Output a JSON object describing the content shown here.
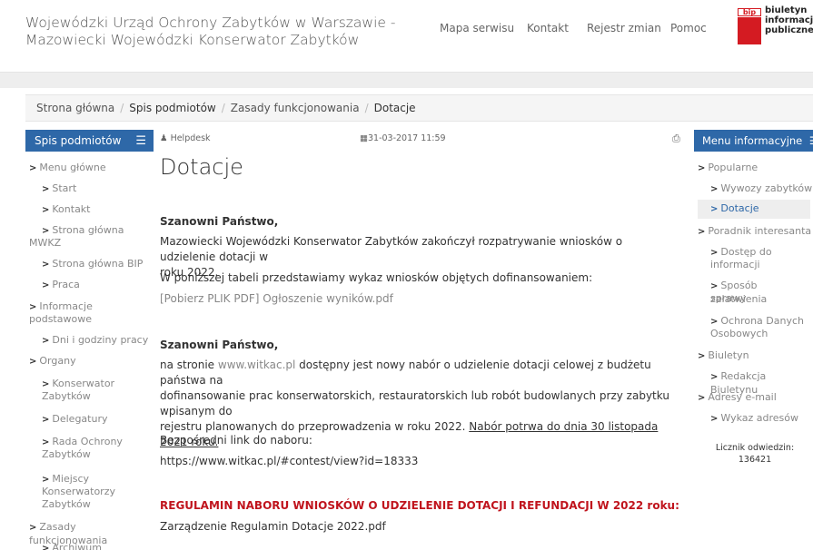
{
  "header": {
    "title_line1": "Wojewódzki Urząd Ochrony Zabytków w Warszawie -",
    "title_line2": "Mazowiecki Wojewódzki Konserwator Zabytków",
    "nav": [
      "Mapa serwisu",
      "Kontakt",
      "Rejestr zmian",
      "Pomoc"
    ],
    "bip": {
      "mark": "bip",
      "line1": "biuletyn",
      "line2": "informacji",
      "line3": "publicznej"
    }
  },
  "breadcrumb": [
    "Strona główna",
    "Spis podmiotów",
    "Zasady funkcjonowania",
    "Dotacje"
  ],
  "left_sidebar": {
    "title": "Spis podmiotów",
    "items": [
      "Menu główne",
      "Start",
      "Kontakt",
      "Strona główna",
      "MWKZ",
      "Strona główna BIP",
      "Praca",
      "Informacje",
      "podstawowe",
      "Dni i godziny pracy",
      "Organy",
      "Konserwator",
      "Zabytków",
      "Delegatury",
      "Rada Ochrony",
      "Zabytków",
      "Miejscy",
      "Konserwatorzy",
      "Zabytków",
      "Zasady funkcjonowania",
      "Archiwum"
    ]
  },
  "article": {
    "author": "Helpdesk",
    "date": "31-03-2017 11:59",
    "title": "Dotacje",
    "greeting1": "Szanowni Państwo,",
    "para1_line1": "Mazowiecki Wojewódzki Konserwator Zabytków zakończył rozpatrywanie wniosków o udzielenie dotacji w",
    "para1_line2": "roku 2022.",
    "para2": "W poniższej tabeli przedstawiamy wykaz wniosków objętych dofinansowaniem:",
    "pdf_link": "[Pobierz PLIK PDF] Ogłoszenie wyników.pdf",
    "greeting2": "Szanowni Państwo,",
    "para3_pre": "na stronie ",
    "para3_link": "www.witkac.pl",
    "para3_line1_rest": " dostępny jest nowy nabór o udzielenie dotacji celowej z budżetu państwa na",
    "para3_line2": "dofinansowanie prac konserwatorskich, restauratorskich lub robót budowlanych przy zabytku wpisanym do",
    "para3_line3_pre": "rejestru planowanych do przeprowadzenia w roku 2022. ",
    "para3_line3_underlined": "Nabór potrwa do dnia 30 listopada 2021 roku.",
    "direct_label": "Bezpośredni link do naboru:",
    "direct_url": "https://www.witkac.pl/#contest/view?id=18333",
    "regulamin_heading": "REGULAMIN NABORU WNIOSKÓW O UDZIELENIE DOTACJI I REFUNDACJI W 2022 roku:",
    "regulamin_file": "Zarządzenie Regulamin Dotacje 2022.pdf"
  },
  "right_sidebar": {
    "title": "Menu informacyjne",
    "items": [
      "Popularne",
      "Wywozy zabytków",
      "Dotacje",
      "Poradnik interesanta",
      "Dostęp do",
      "informacji",
      "Sposób załatwienia",
      "sprawy",
      "Ochrona Danych",
      "Osobowych",
      "Biuletyn",
      "Redakcja Biuletynu",
      "Adresy e-mail",
      "Wykaz adresów"
    ],
    "counter_label": "Licznik odwiedzin:",
    "counter_value": "136421"
  },
  "colors": {
    "accent": "#2e68a8",
    "bip_red": "#d41b22",
    "heading_red": "#c0141d"
  },
  "icons": [
    "chevron-right-icon",
    "hamburger-icon",
    "user-icon",
    "calendar-icon",
    "print-icon"
  ]
}
